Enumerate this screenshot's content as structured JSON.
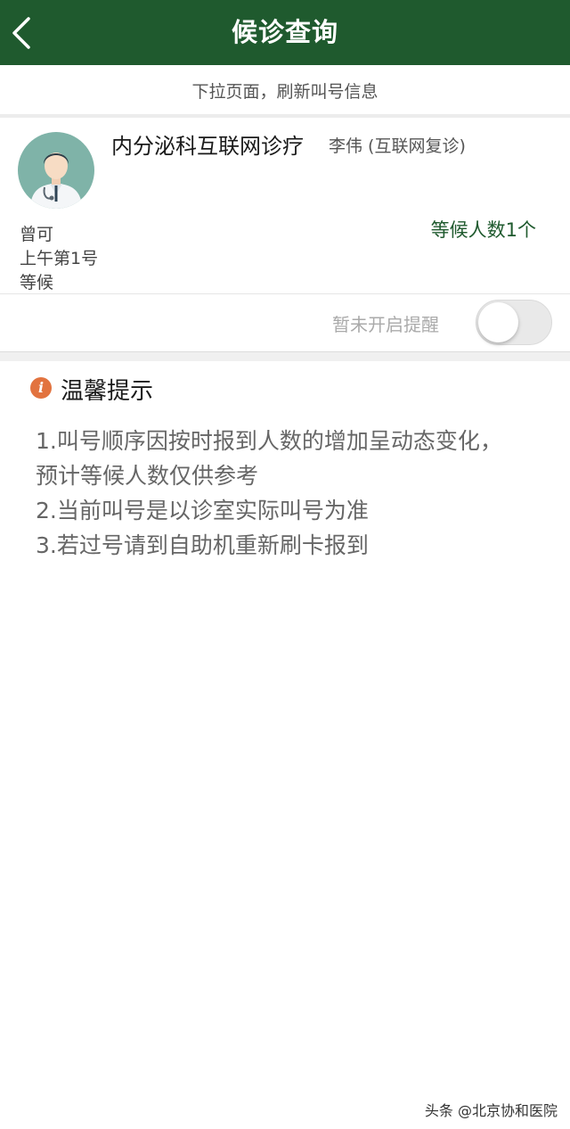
{
  "header": {
    "title": "候诊查询",
    "back_icon": "chevron-left-icon"
  },
  "refresh_hint": "下拉页面，刷新叫号信息",
  "appointment": {
    "avatar_icon": "doctor-avatar-icon",
    "department": "内分泌科互联网诊疗",
    "doctor": "李伟 (互联网复诊)",
    "patient_name": "曾可",
    "slot": "上午第1号",
    "status": "等候",
    "waiting_count": "等候人数1个",
    "reminder_label": "暂未开启提醒",
    "reminder_enabled": false
  },
  "tips": {
    "icon": "info-icon",
    "title": "温馨提示",
    "items": [
      "1.叫号顺序因按时报到人数的增加呈动态变化，预计等候人数仅供参考",
      "2.当前叫号是以诊室实际叫号为准",
      "3.若过号请到自助机重新刷卡报到"
    ]
  },
  "watermark": "头条 @北京协和医院",
  "colors": {
    "header_bg": "#1f5a2e",
    "accent_text": "#1f5a2e",
    "info_icon": "#e2733f"
  }
}
